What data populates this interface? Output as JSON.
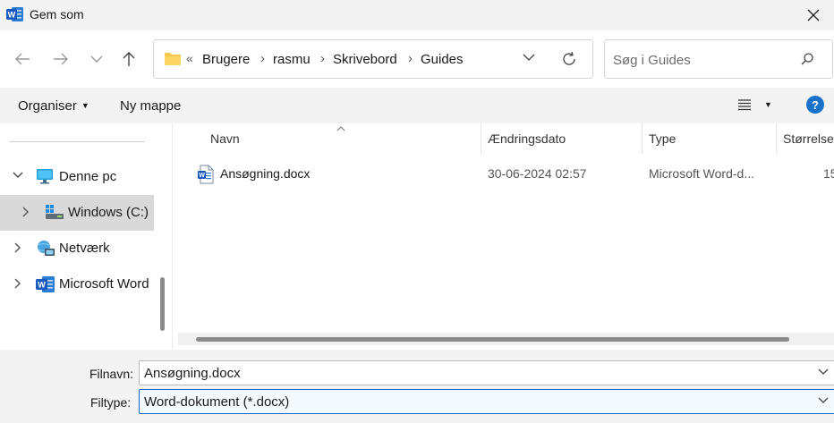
{
  "window": {
    "title": "Gem som",
    "app_icon": "word-icon"
  },
  "navigation": {
    "back_icon": "arrow-left-icon",
    "forward_icon": "arrow-right-icon",
    "recent_icon": "chevron-down-icon",
    "up_icon": "arrow-up-icon",
    "address": {
      "overflow": "«",
      "crumbs": [
        "Brugere",
        "rasmu",
        "Skrivebord",
        "Guides"
      ],
      "separator": "›"
    },
    "search_placeholder": "Søg i Guides"
  },
  "toolbar": {
    "organise": "Organiser",
    "new_folder": "Ny mappe",
    "help": "?"
  },
  "sidebar": {
    "items": [
      {
        "label": "Denne pc",
        "icon": "monitor-icon",
        "expanded": true
      },
      {
        "label": "Windows (C:)",
        "icon": "drive-icon",
        "selected": true
      },
      {
        "label": "Netværk",
        "icon": "network-icon"
      },
      {
        "label": "Microsoft Word",
        "icon": "word-icon"
      }
    ]
  },
  "files": {
    "columns": [
      "Navn",
      "Ændringsdato",
      "Type",
      "Størrelse"
    ],
    "rows": [
      {
        "name": "Ansøgning.docx",
        "date": "30-06-2024 02:57",
        "type": "Microsoft Word-d...",
        "size": "15"
      }
    ]
  },
  "bottom": {
    "filename_label": "Filnavn:",
    "filename_value": "Ansøgning.docx",
    "filetype_label": "Filtype:",
    "filetype_value": "Word-dokument (*.docx)"
  },
  "colors": {
    "accent": "#0b6ac4",
    "word_blue": "#185abd",
    "selected_bg": "#d9d9d9"
  }
}
